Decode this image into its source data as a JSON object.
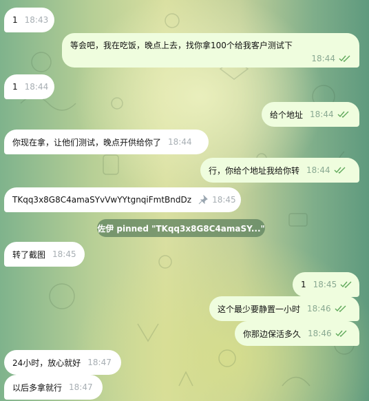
{
  "messages": [
    {
      "text": "1",
      "time": "18:43"
    },
    {
      "text": "等会吧，我在吃饭，晚点上去，找你拿100个给我客户测试下",
      "time": "18:44"
    },
    {
      "text": "1",
      "time": "18:44"
    },
    {
      "text": "给个地址",
      "time": "18:44"
    },
    {
      "text": "你现在拿，让他们测试，晚点开供给你了",
      "time": "18:44"
    },
    {
      "text": "行，你给个地址我给你转",
      "time": "18:44"
    },
    {
      "text": "TKqq3x8G8C4amaSYvVwYYtgnqiFmtBndDz",
      "time": "18:45"
    },
    {
      "text": "转了截图",
      "time": "18:45"
    },
    {
      "text": "1",
      "time": "18:45"
    },
    {
      "text": "这个最少要静置一小时",
      "time": "18:46"
    },
    {
      "text": "你那边保活多久",
      "time": "18:46"
    },
    {
      "text": "24小时，放心就好",
      "time": "18:47"
    },
    {
      "text": "以后多拿就行",
      "time": "18:47"
    }
  ],
  "service": {
    "text": "佐伊 pinned \"TKqq3x8G8C4amaSY...\""
  },
  "colors": {
    "incoming": "#ffffff",
    "outgoing": "#effdde",
    "check": "#5fa85a"
  }
}
